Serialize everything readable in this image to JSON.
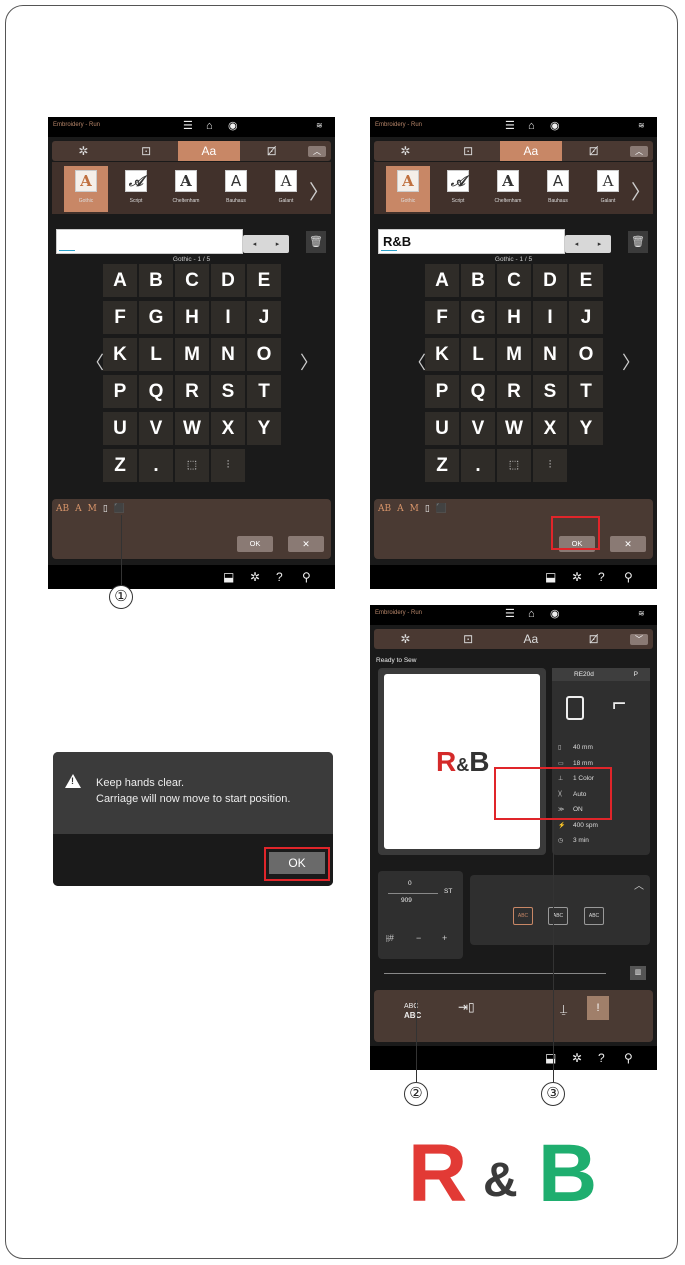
{
  "screen": {
    "title": "Embroidery - Run",
    "tabs": [
      "✲",
      "⊡",
      "Aa",
      "⊡̸"
    ],
    "fonts": [
      {
        "letter": "A",
        "name": "Gothic"
      },
      {
        "letter": "𝒜",
        "name": "Script"
      },
      {
        "letter": "A",
        "name": "Cheltenham"
      },
      {
        "letter": "A",
        "name": "Bauhaus"
      },
      {
        "letter": "A",
        "name": "Galant"
      }
    ],
    "page_indicator": "Gothic - 1 / 5",
    "keys": [
      [
        "A",
        "B",
        "C",
        "D",
        "E"
      ],
      [
        "F",
        "G",
        "H",
        "I",
        "J"
      ],
      [
        "K",
        "L",
        "M",
        "N",
        "O"
      ],
      [
        "P",
        "Q",
        "R",
        "S",
        "T"
      ],
      [
        "U",
        "V",
        "W",
        "X",
        "Y"
      ],
      [
        "Z",
        ".",
        "⬚",
        "⫶"
      ]
    ],
    "ok_label": "OK",
    "cancel_label": "✕",
    "left_text_value": "",
    "right_text_value": "R&B",
    "size_icons": [
      "AB",
      "A",
      "M"
    ]
  },
  "dialog": {
    "line1": "Keep hands clear.",
    "line2": "Carriage will now move to start position.",
    "ok_label": "OK"
  },
  "sew": {
    "ready_label": "Ready to Sew",
    "hoop": "RE20d",
    "foot": "P",
    "preview_text": {
      "r": "R",
      "amp": "&",
      "b": "B"
    },
    "specs": [
      {
        "icon": "▯",
        "value": "40 mm"
      },
      {
        "icon": "▭",
        "value": "18 mm"
      },
      {
        "icon": "⊥",
        "value": "1 Color"
      },
      {
        "icon": ")(",
        "value": "Auto"
      },
      {
        "icon": "≫",
        "value": "ON"
      },
      {
        "icon": "⚡",
        "value": "400 spm"
      },
      {
        "icon": "◷",
        "value": "3 min"
      }
    ],
    "stitch_current": "0",
    "stitch_total": "909",
    "stitch_unit": "ST",
    "trace_buttons": [
      "ABC",
      "ABC",
      "ABC"
    ],
    "abc_icon_top": "ABC",
    "abc_icon_bottom": "ABC"
  },
  "callouts": [
    "①",
    "②",
    "③"
  ],
  "result": {
    "r": "R",
    "amp": "&",
    "b": "B"
  },
  "colors": {
    "accent": "#c88766",
    "highlight": "#e0252a",
    "red_thread": "#e23a35",
    "green_thread": "#1fae6f"
  }
}
